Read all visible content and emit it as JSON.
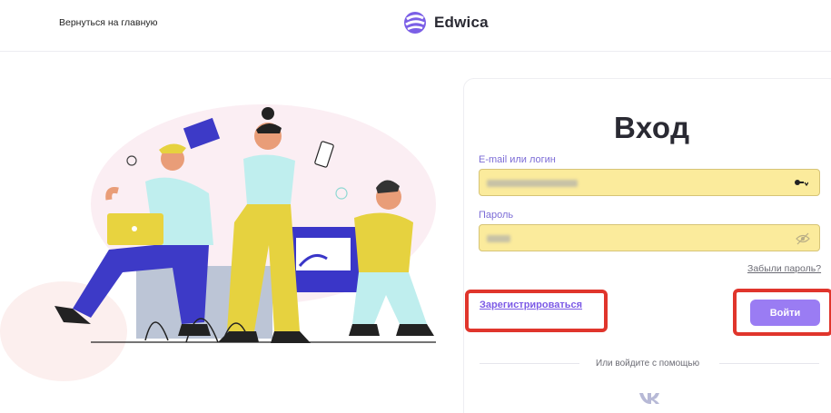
{
  "header": {
    "back_link": "Вернуться на главную",
    "logo_text": "Edwica"
  },
  "form": {
    "title": "Вход",
    "login_label": "E-mail или логин",
    "login_value_obscured": true,
    "password_label": "Пароль",
    "forgot_link": "Забыли пароль?",
    "register_link": "Зарегистрироваться",
    "login_button": "Войти",
    "alt_login_text": "Или войдите с помощью",
    "alt_providers": [
      "vk-icon"
    ]
  },
  "colors": {
    "accent": "#9a7cf3",
    "link": "#7c5ae6",
    "autofill": "#fbeb9c",
    "highlight": "#e0352c"
  }
}
